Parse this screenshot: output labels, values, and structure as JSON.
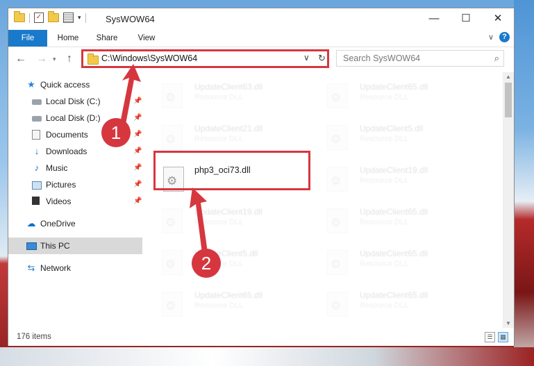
{
  "window": {
    "title": "SysWOW64",
    "controls": {
      "minimize": "—",
      "maximize": "☐",
      "close": "✕"
    }
  },
  "quick_access_toolbar": {
    "check_glyph": "✓",
    "dropdown_glyph": "▾"
  },
  "ribbon": {
    "tabs": [
      {
        "label": "File"
      },
      {
        "label": "Home"
      },
      {
        "label": "Share"
      },
      {
        "label": "View"
      }
    ],
    "expand_glyph": "∨",
    "help_glyph": "?"
  },
  "nav": {
    "back_glyph": "←",
    "forward_glyph": "→",
    "recent_glyph": "▾",
    "up_glyph": "↑",
    "address": "C:\\Windows\\SysWOW64",
    "address_dropdown_glyph": "∨",
    "refresh_glyph": "↻",
    "search_placeholder": "Search SysWOW64",
    "search_glyph": "⌕"
  },
  "sidebar": {
    "quick_access": {
      "label": "Quick access"
    },
    "items": [
      {
        "label": "Local Disk (C:)",
        "icon": "drive-icon",
        "pinned": true
      },
      {
        "label": "Local Disk (D:)",
        "icon": "drive-icon",
        "pinned": true
      },
      {
        "label": "Documents",
        "icon": "documents-icon",
        "pinned": true
      },
      {
        "label": "Downloads",
        "icon": "downloads-icon",
        "pinned": true
      },
      {
        "label": "Music",
        "icon": "music-icon",
        "pinned": true
      },
      {
        "label": "Pictures",
        "icon": "pictures-icon",
        "pinned": true
      },
      {
        "label": "Videos",
        "icon": "videos-icon",
        "pinned": true
      }
    ],
    "pin_glyph": "📌",
    "onedrive": {
      "label": "OneDrive"
    },
    "this_pc": {
      "label": "This PC"
    },
    "network": {
      "label": "Network"
    }
  },
  "files": [
    {
      "name": "UpdateClient63.dll",
      "type": "Resource DLL"
    },
    {
      "name": "UpdateClient65.dll",
      "type": "Resource DLL"
    },
    {
      "name": "UpdateClient21.dll",
      "type": "Resource DLL"
    },
    {
      "name": "UpdateClient5.dll",
      "type": "Resource DLL"
    },
    {
      "name": "php3_oci73.dll",
      "type": ""
    },
    {
      "name": "UpdateClient19.dll",
      "type": "Resource DLL"
    },
    {
      "name": "UpdateClient19.dll",
      "type": "Resource DLL"
    },
    {
      "name": "UpdateClient65.dll",
      "type": "Resource DLL"
    },
    {
      "name": "UpdateClient5.dll",
      "type": "Resource DLL"
    },
    {
      "name": "UpdateClient65.dll",
      "type": "Resource DLL"
    },
    {
      "name": "UpdateClient65.dll",
      "type": "Resource DLL"
    },
    {
      "name": "UpdateClient65.dll",
      "type": "Resource DLL"
    }
  ],
  "status": {
    "item_count": "176 items"
  },
  "annotations": {
    "step1": "1",
    "step2": "2",
    "color": "#d6373f"
  }
}
